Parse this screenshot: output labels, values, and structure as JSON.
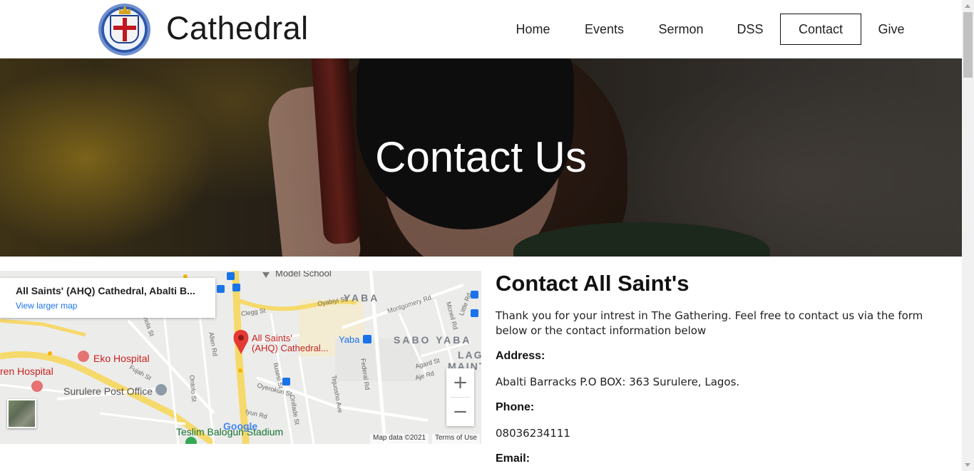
{
  "header": {
    "brand": "Cathedral",
    "logo_icon": "church-crest-logo-icon",
    "nav": [
      {
        "label": "Home",
        "active": false
      },
      {
        "label": "Events",
        "active": false
      },
      {
        "label": "Sermon",
        "active": false
      },
      {
        "label": "DSS",
        "active": false
      },
      {
        "label": "Contact",
        "active": true
      },
      {
        "label": "Give",
        "active": false
      }
    ]
  },
  "hero": {
    "title": "Contact Us"
  },
  "map": {
    "place_name": "All Saints' (AHQ) Cathedral, Abalti B...",
    "view_larger": "View larger map",
    "pin_label_line1": "All Saints'",
    "pin_label_line2": "(AHQ) Cathedral...",
    "labels": {
      "model_school": "Model School",
      "yaba_area": "YABA",
      "yaba": "Yaba",
      "sabo_yaba": "SABO YABA",
      "lag": "LAG",
      "maint": "MAINT",
      "eko_hospital": "Eko Hospital",
      "ren_hospital": "ren Hospital",
      "surulere_post_office": "Surulere Post Office",
      "teslim_stadium": "Teslim Balogun Stadium",
      "montgomery": "Montgomery Rd",
      "federal_rd": "Federal Rd",
      "clegg": "Clegg St",
      "oyerokun": "Oyerokun St",
      "allen": "Allen Rd",
      "ishola": "Ishola St",
      "fujah": "Fujah St",
      "iyun": "Iyun Rd",
      "oyabiyi": "Oyabiyi St",
      "agard": "Agard St",
      "aje": "Aje Rd",
      "mcneil": "Mcneil Rd",
      "little": "Little Rd",
      "tejuosho": "Tejuosho Ave",
      "ilusesi": "Ilusesi St",
      "onifade": "Onifade St",
      "ontolo": "Ontolo St",
      "google": "Google"
    },
    "zoom_in": "+",
    "zoom_out": "−",
    "map_data": "Map data ©2021",
    "terms": "Terms of Use"
  },
  "contact": {
    "title": "Contact All Saint's",
    "intro": "Thank you for your intrest in The Gathering. Feel free to contact us via the form below or the contact information below",
    "address_label": "Address:",
    "address": "Abalti Barracks P.O BOX: 363 Surulere, Lagos.",
    "phone_label": "Phone:",
    "phone": "08036234111",
    "email_label": "Email:"
  },
  "colors": {
    "map_pin": "#e53935",
    "link": "#1a73e8",
    "nav_border": "#111111"
  }
}
